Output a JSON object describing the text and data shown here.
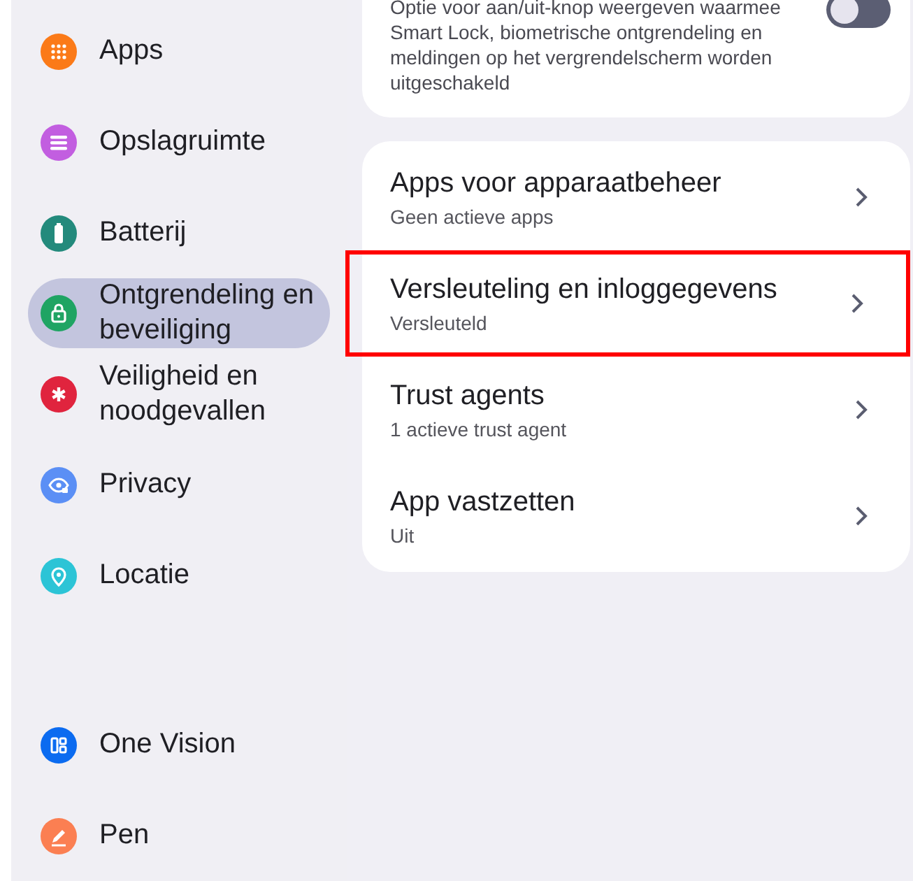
{
  "sidebar": {
    "items": [
      {
        "label": "Apps",
        "color": "#fb7a18",
        "selected": false
      },
      {
        "label": "Opslagruimte",
        "color": "#c25ee0",
        "selected": false
      },
      {
        "label": "Batterij",
        "color": "#238a7c",
        "selected": false
      },
      {
        "label": "Ontgrendeling en beveiliging",
        "color": "#1fa463",
        "selected": true
      },
      {
        "label": "Veiligheid en noodgevallen",
        "color": "#e0243e",
        "selected": false
      },
      {
        "label": "Privacy",
        "color": "#5b8ff5",
        "selected": false
      },
      {
        "label": "Locatie",
        "color": "#2cc4d6",
        "selected": false
      },
      {
        "kind": "divider"
      },
      {
        "label": "One Vision",
        "color": "#0b6bf0",
        "selected": false
      },
      {
        "label": "Pen",
        "color": "#fb7f52",
        "selected": false
      }
    ]
  },
  "toggle_card": {
    "description": "Optie voor aan/uit-knop weergeven waarmee Smart Lock, biometrische ontgrendeling en meldingen op het vergrendelscherm worden uitgeschakeld",
    "on": false
  },
  "settings_card": {
    "items": [
      {
        "title": "Apps voor apparaatbeheer",
        "subtitle": "Geen actieve apps",
        "highlighted": false
      },
      {
        "title": "Versleuteling en inloggegevens",
        "subtitle": "Versleuteld",
        "highlighted": true
      },
      {
        "title": "Trust agents",
        "subtitle": "1 actieve trust agent",
        "highlighted": false
      },
      {
        "title": "App vastzetten",
        "subtitle": "Uit",
        "highlighted": false
      }
    ]
  }
}
